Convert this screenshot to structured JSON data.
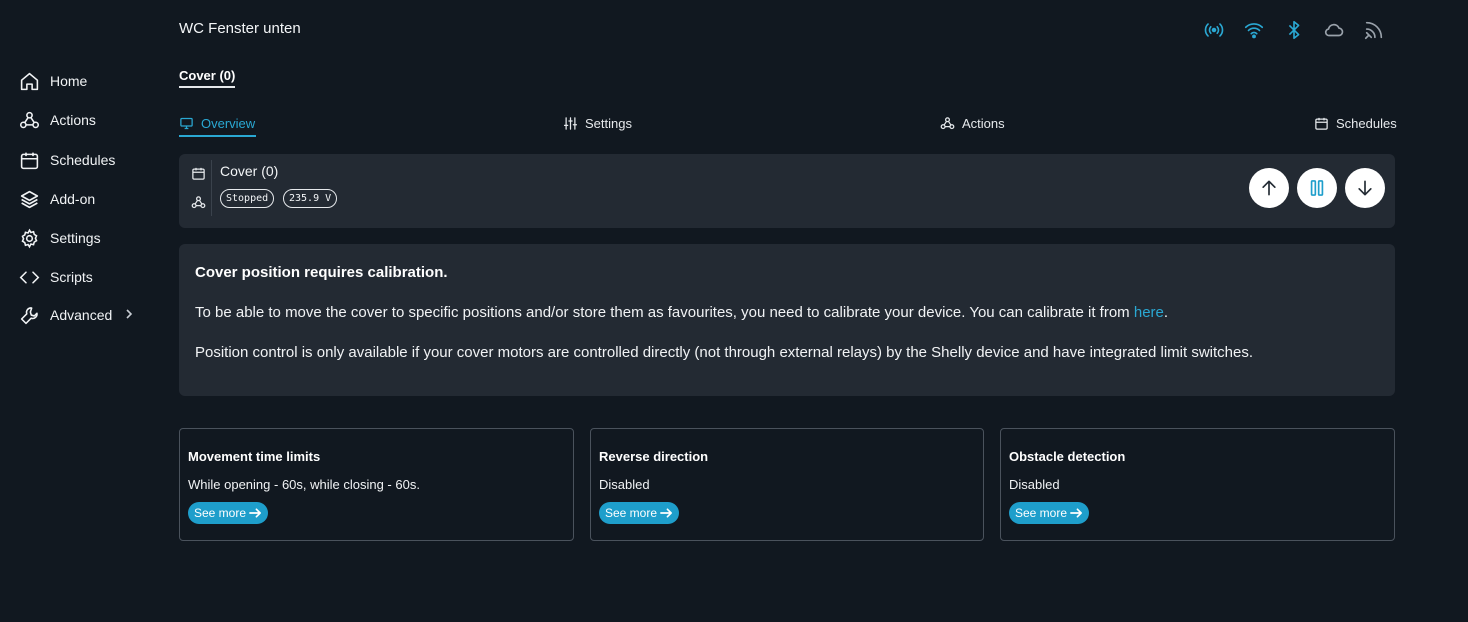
{
  "sidebar": {
    "items": [
      {
        "label": "Home",
        "icon": "home-icon"
      },
      {
        "label": "Actions",
        "icon": "actions-icon"
      },
      {
        "label": "Schedules",
        "icon": "calendar-icon"
      },
      {
        "label": "Add-on",
        "icon": "layers-icon"
      },
      {
        "label": "Settings",
        "icon": "gear-icon"
      },
      {
        "label": "Scripts",
        "icon": "code-icon"
      },
      {
        "label": "Advanced",
        "icon": "wrench-icon"
      }
    ]
  },
  "header": {
    "device_name": "WC Fenster unten",
    "status_icons": [
      "broadcast-icon",
      "wifi-icon",
      "bluetooth-icon",
      "cloud-icon",
      "rss-icon"
    ]
  },
  "component_tab": "Cover (0)",
  "subtabs": [
    {
      "label": "Overview",
      "icon": "monitor-icon",
      "active": true
    },
    {
      "label": "Settings",
      "icon": "sliders-icon"
    },
    {
      "label": "Actions",
      "icon": "actions-icon"
    },
    {
      "label": "Schedules",
      "icon": "calendar-icon"
    }
  ],
  "cover": {
    "name": "Cover (0)",
    "state_badge": "Stopped",
    "voltage_badge": "235.9 V",
    "controls": [
      "arrow-up-icon",
      "pause-icon",
      "arrow-down-icon"
    ]
  },
  "notice": {
    "title": "Cover position requires calibration.",
    "p1_text": "To be able to move the cover to specific positions and/or store them as favourites, you need to calibrate your device. You can calibrate it from ",
    "p1_link": "here",
    "p1_end": ".",
    "p2_text": "Position control is only available if your cover motors are controlled directly (not through external relays) by the Shelly device and have integrated limit switches."
  },
  "cards": [
    {
      "title": "Movement time limits",
      "value": "While opening - 60s, while closing - 60s.",
      "button": "See more"
    },
    {
      "title": "Reverse direction",
      "value": "Disabled",
      "button": "See more"
    },
    {
      "title": "Obstacle detection",
      "value": "Disabled",
      "button": "See more"
    }
  ],
  "colors": {
    "background": "#111820",
    "panel": "#232a33",
    "accent": "#2aa8d3",
    "button": "#1e9ecb"
  }
}
